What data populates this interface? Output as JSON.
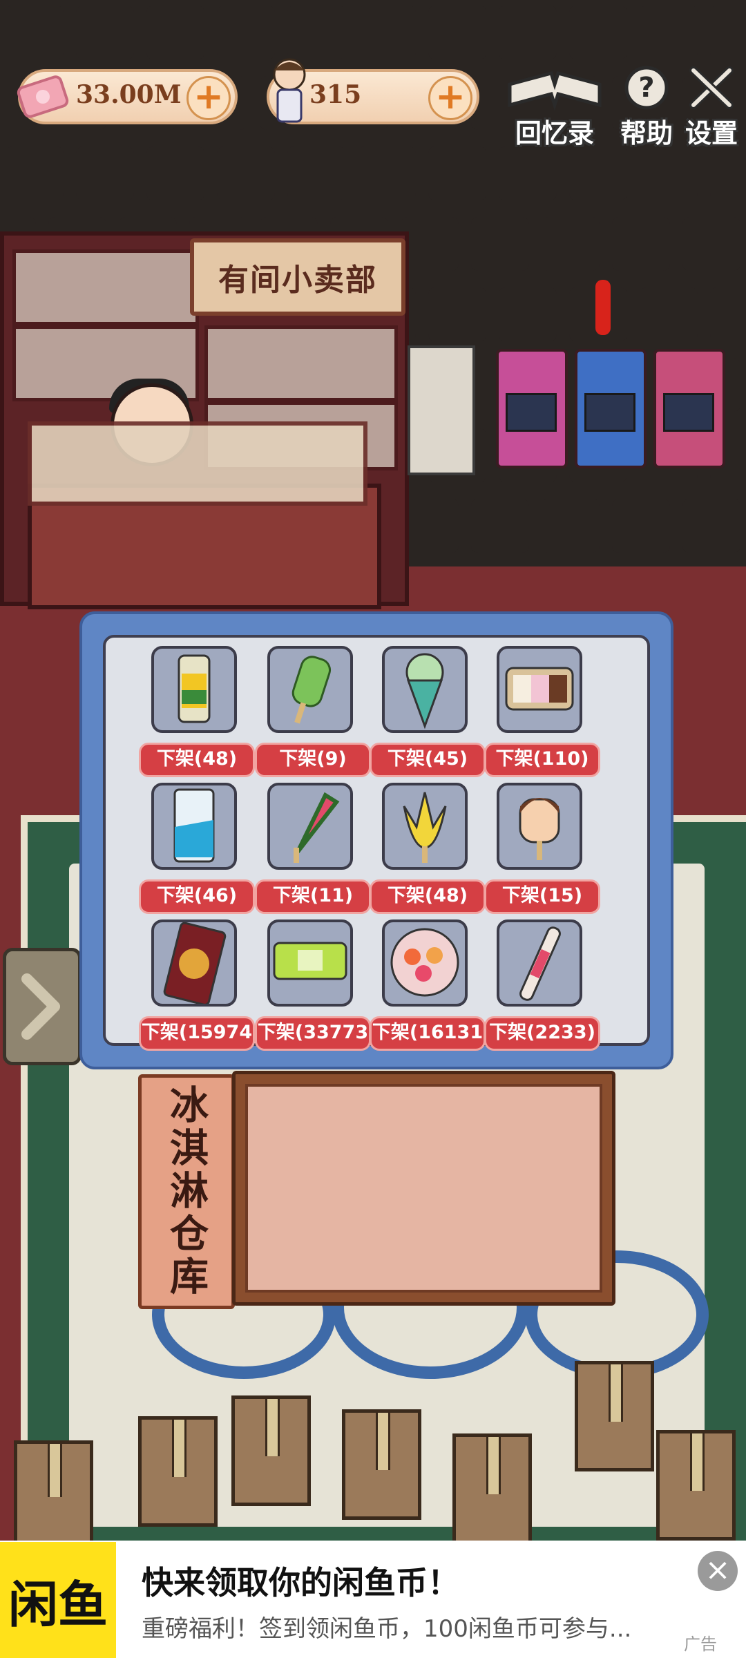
{
  "hud": {
    "money": "33.00M",
    "visitors": "315",
    "memoir_label": "回忆录",
    "help_label": "帮助",
    "settings_label": "设置"
  },
  "shop": {
    "sign": "有间小卖部"
  },
  "warehouse": {
    "title": "冰淇淋仓库",
    "items": [
      {
        "icon": "corn-ice-cream-icon",
        "button": "下架(48)"
      },
      {
        "icon": "green-popsicle-icon",
        "button": "下架(9)"
      },
      {
        "icon": "cone-icon",
        "button": "下架(45)"
      },
      {
        "icon": "ice-cream-tub-icon",
        "button": "下架(110)"
      },
      {
        "icon": "blue-ice-bar-icon",
        "button": "下架(46)"
      },
      {
        "icon": "watermelon-popsicle-icon",
        "button": "下架(11)"
      },
      {
        "icon": "banana-popsicle-icon",
        "button": "下架(48)"
      },
      {
        "icon": "face-popsicle-icon",
        "button": "下架(15)"
      },
      {
        "icon": "chocolate-bar-icon",
        "button": "下架(15974"
      },
      {
        "icon": "green-wrapper-icon",
        "button": "下架(33773"
      },
      {
        "icon": "fruit-bowl-icon",
        "button": "下架(16131"
      },
      {
        "icon": "tube-ice-icon",
        "button": "下架(2233)"
      }
    ]
  },
  "ad": {
    "logo": "闲鱼",
    "title": "快来领取你的闲鱼币！",
    "subtitle": "重磅福利！签到领闲鱼币，100闲鱼币可参与...",
    "tag": "广告",
    "close": "×"
  }
}
